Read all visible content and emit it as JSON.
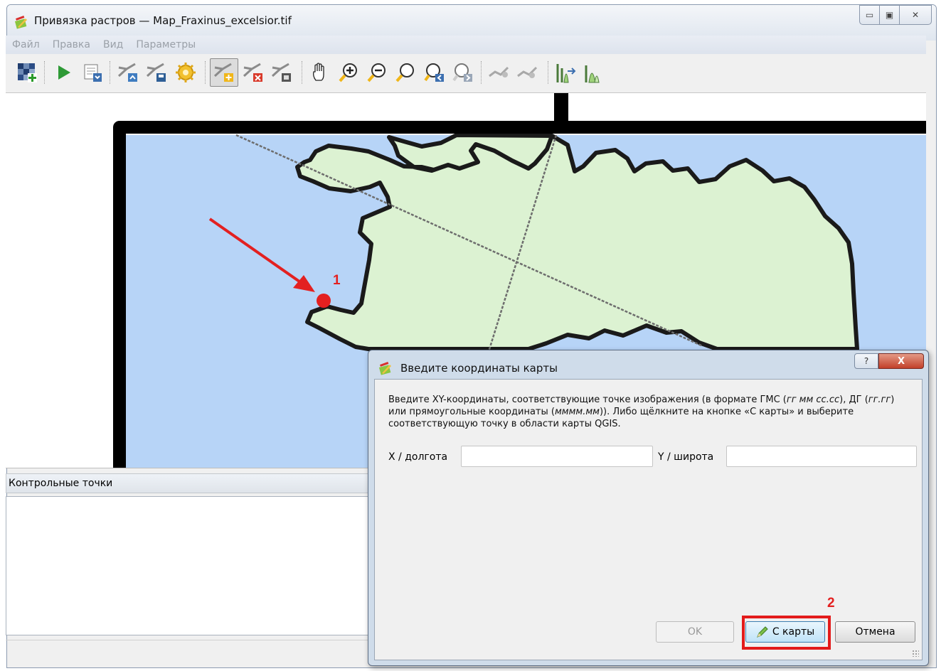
{
  "window": {
    "title": "Привязка растров — Map_Fraxinus_excelsior.tif",
    "controls": {
      "minimize": "▭",
      "maximize": "▣",
      "close": "✕"
    }
  },
  "menu": [
    "Файл",
    "Правка",
    "Вид",
    "Параметры"
  ],
  "toolbar": {
    "icons": [
      "open-raster-icon",
      "start-georeferencing-icon",
      "generate-gdal-script-icon",
      "load-gcp-icon",
      "save-gcp-icon",
      "transformation-settings-icon",
      "add-point-icon",
      "delete-point-icon",
      "move-gcp-icon",
      "pan-icon",
      "zoom-in-icon",
      "zoom-out-icon",
      "zoom-to-layer-icon",
      "zoom-last-icon",
      "zoom-next-icon",
      "link-georeferencer-to-qgis-icon",
      "link-qgis-to-georeferencer-icon",
      "full-histogram-stretch-icon",
      "local-histogram-stretch-icon"
    ],
    "checked": "add-point-icon"
  },
  "map": {
    "water_color": "#b7d4f7",
    "land_color": "#dcf2d2",
    "outline_color": "#000000",
    "marker_color": "#e32020"
  },
  "annotations": {
    "marker_number": "1",
    "button_number": "2"
  },
  "gcp_panel": {
    "title": "Контрольные точки"
  },
  "dialog": {
    "title": "Введите координаты карты",
    "help": "?",
    "close": "X",
    "instruction": {
      "p1": "Введите XY-координаты, соответствующие точке изображения (в формате ГМС (",
      "i1": "гг мм сс.сс",
      "p2": "), ДГ (",
      "i2": "гг.гг",
      "p3": ") или прямоугольные координаты (",
      "i3": "мммм.мм",
      "p4": ")). Либо щёлкните на кнопке «С карты» и выберите соответствующую точку в области карты QGIS."
    },
    "x_label": "X / долгота",
    "y_label": "Y / широта",
    "x_value": "",
    "y_value": "",
    "ok_label": "OK",
    "from_map_label": "С карты",
    "cancel_label": "Отмена"
  }
}
